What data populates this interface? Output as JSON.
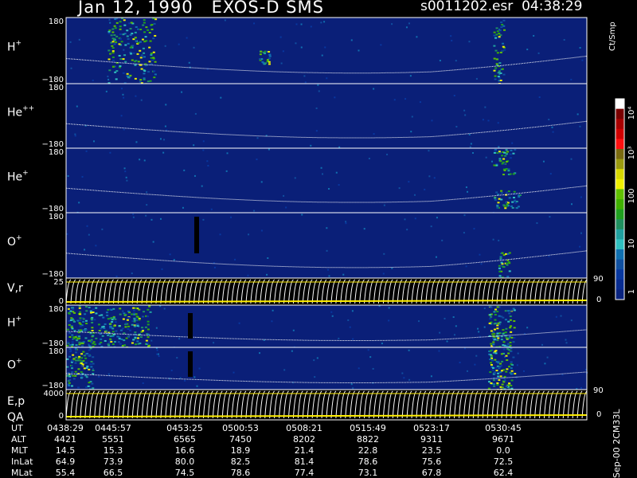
{
  "header": {
    "title": "Jan 12, 1990   EXOS-D SMS",
    "file_time": "s0011202.esr  04:38:29"
  },
  "colorbar": {
    "title": "Ct/Smp",
    "ticks": [
      "10⁴",
      "10³",
      "100",
      "10",
      "1"
    ],
    "colors": [
      "#ffffff",
      "#7a0000",
      "#a80000",
      "#d00000",
      "#ff1010",
      "#7a6a10",
      "#9a9a10",
      "#d8d800",
      "#f0f000",
      "#60c000",
      "#40b000",
      "#20a020",
      "#209060",
      "#20a0a0",
      "#30c0c0",
      "#1070b0",
      "#1050a0",
      "#0838a0",
      "#082c90",
      "#0a2480"
    ]
  },
  "chart_data": {
    "type": "heatmap",
    "background_color": "#0a1f78",
    "ut_start": "04:38:29",
    "panels": [
      {
        "name": "H+",
        "label": "H",
        "sup": "+",
        "ymax": "180",
        "ymin": "−180",
        "blobs": [
          [
            0.08,
            0.17,
            0.0,
            1.0
          ],
          [
            0.82,
            0.84,
            0.0,
            1.0
          ],
          [
            0.37,
            0.39,
            0.5,
            0.7
          ]
        ]
      },
      {
        "name": "He++",
        "label": "He",
        "sup": "++",
        "ymax": "180",
        "ymin": "−180",
        "blobs": []
      },
      {
        "name": "He+",
        "label": "He",
        "sup": "+",
        "ymax": "180",
        "ymin": "−180",
        "blobs": [
          [
            0.82,
            0.86,
            0.0,
            0.4
          ],
          [
            0.82,
            0.87,
            0.65,
            0.95
          ]
        ]
      },
      {
        "name": "O+",
        "label": "O",
        "sup": "+",
        "ymax": "180",
        "ymin": "−180",
        "blobs": [
          [
            0.83,
            0.85,
            0.6,
            1.0
          ]
        ]
      },
      {
        "name": "V,r",
        "label": "V,r",
        "sup": "",
        "ymax": "25",
        "ymin": "0",
        "right_max": "90",
        "right_min": "0"
      },
      {
        "name": "H+ (2)",
        "label": "H",
        "sup": "+",
        "ymax": "180",
        "ymin": "−180",
        "blobs": [
          [
            0.0,
            0.16,
            0.0,
            1.0
          ],
          [
            0.81,
            0.86,
            0.0,
            1.0
          ]
        ]
      },
      {
        "name": "O+ (2)",
        "label": "O",
        "sup": "+",
        "ymax": "180",
        "ymin": "−180",
        "blobs": [
          [
            0.0,
            0.05,
            0.0,
            1.0
          ],
          [
            0.81,
            0.86,
            0.0,
            1.0
          ]
        ]
      },
      {
        "name": "E,p QA",
        "label": "E,p",
        "label2": "QA",
        "ymax": "4000",
        "ymin": "0",
        "right_max": "90",
        "right_min": "0"
      }
    ]
  },
  "table": {
    "rows": [
      {
        "label": "UT",
        "values": [
          "0438:29",
          "0445:57",
          "0453:25",
          "0500:53",
          "0508:21",
          "0515:49",
          "0523:17",
          "0530:45"
        ]
      },
      {
        "label": "ALT",
        "values": [
          "4421",
          "5551",
          "6565",
          "7450",
          "8202",
          "8822",
          "9311",
          "9671"
        ]
      },
      {
        "label": "MLT",
        "values": [
          "14.5",
          "15.3",
          "16.6",
          "18.9",
          "21.4",
          "22.8",
          "23.5",
          "0.0"
        ]
      },
      {
        "label": "InLat",
        "values": [
          "64.9",
          "73.9",
          "80.0",
          "82.5",
          "81.4",
          "78.6",
          "75.6",
          "72.5"
        ]
      },
      {
        "label": "MLat",
        "values": [
          "55.4",
          "66.5",
          "74.5",
          "78.6",
          "77.4",
          "73.1",
          "67.8",
          "62.4"
        ]
      }
    ]
  },
  "footer": {
    "note": "Sep-00 2CM33L"
  }
}
